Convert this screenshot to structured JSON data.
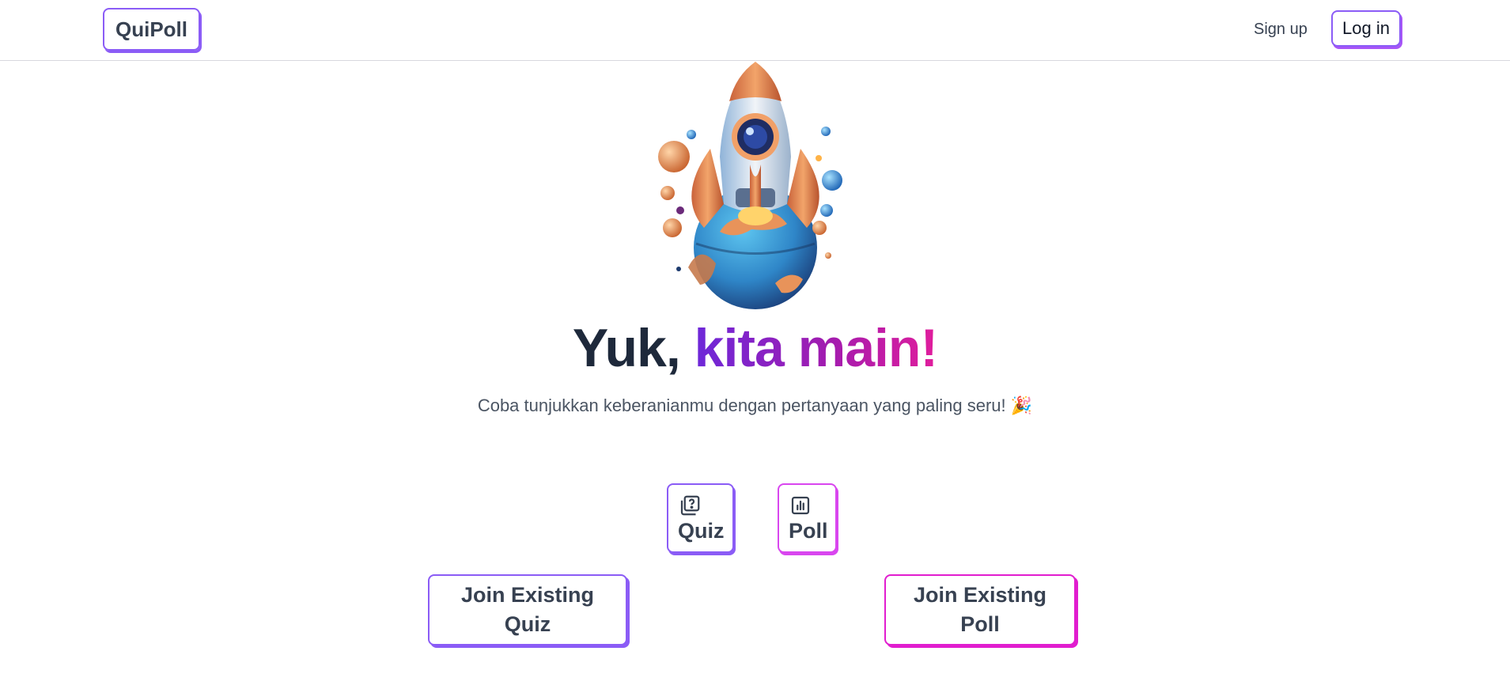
{
  "header": {
    "logo": "QuiPoll",
    "signup_label": "Sign up",
    "login_label": "Log in"
  },
  "hero": {
    "image_icon": "rocket-on-planet-illustration",
    "headline_part1": "Yuk,",
    "headline_part2": "kita main!",
    "subtitle": "Coba tunjukkan keberanianmu dengan pertanyaan yang paling seru! 🎉"
  },
  "modes": {
    "quiz": {
      "label": "Quiz",
      "icon": "quiz-icon"
    },
    "poll": {
      "label": "Poll",
      "icon": "poll-chart-icon"
    }
  },
  "join": {
    "quiz_label": "Join Existing Quiz",
    "poll_label": "Join Existing Poll"
  },
  "colors": {
    "accent_purple": "#8b5cf6",
    "accent_magenta": "#d946ef",
    "text_dark": "#1e293b"
  }
}
